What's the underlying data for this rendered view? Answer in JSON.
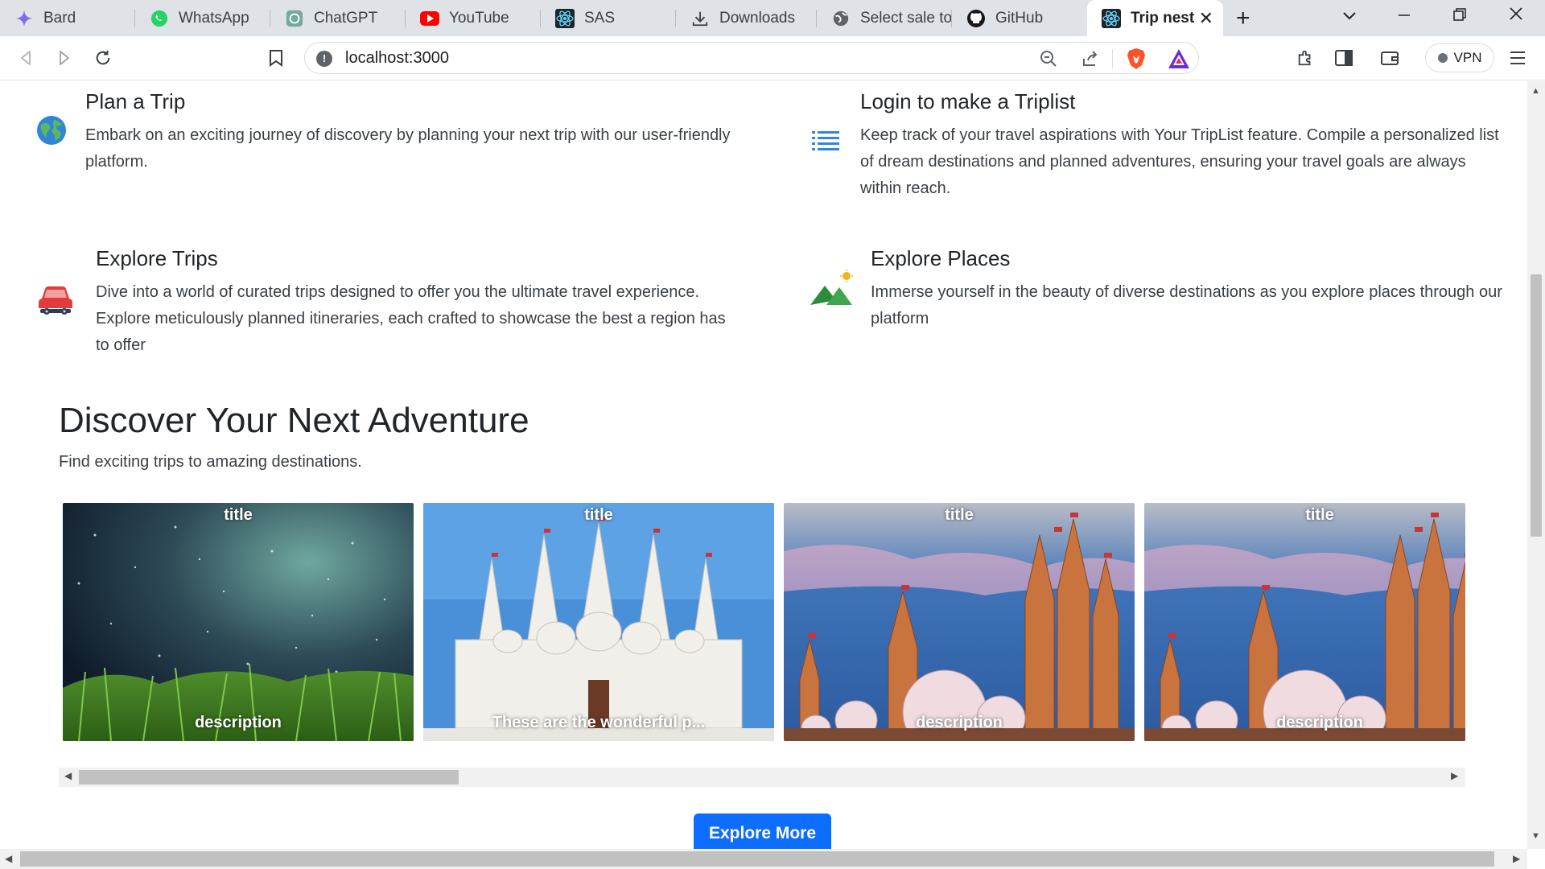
{
  "browser": {
    "tabs": [
      {
        "label": "Bard",
        "icon": "bard-icon"
      },
      {
        "label": "WhatsApp",
        "icon": "whatsapp-icon"
      },
      {
        "label": "ChatGPT",
        "icon": "chatgpt-icon"
      },
      {
        "label": "YouTube",
        "icon": "youtube-icon"
      },
      {
        "label": "SAS",
        "icon": "react-icon"
      },
      {
        "label": "Downloads",
        "icon": "download-icon"
      },
      {
        "label": "Select sale to",
        "icon": "globe-icon"
      },
      {
        "label": "GitHub",
        "icon": "github-icon"
      },
      {
        "label": "Trip nest",
        "icon": "react-icon",
        "active": true
      }
    ],
    "url": "localhost:3000",
    "vpn_label": "VPN"
  },
  "features": [
    {
      "title": "Plan a Trip",
      "description": "Embark on an exciting journey of discovery by planning your next trip with our user-friendly platform.",
      "icon": "globe-icon"
    },
    {
      "title": "Login to make a Triplist",
      "description": "Keep track of your travel aspirations with Your TripList feature. Compile a personalized list of dream destinations and planned adventures, ensuring your travel goals are always within reach.",
      "icon": "list-icon"
    },
    {
      "title": "Explore Trips",
      "description": "Dive into a world of curated trips designed to offer you the ultimate travel experience. Explore meticulously planned itineraries, each crafted to showcase the best a region has to offer",
      "icon": "car-icon"
    },
    {
      "title": "Explore Places",
      "description": "Immerse yourself in the beauty of diverse destinations as you explore places through our platform",
      "icon": "mountain-icon"
    }
  ],
  "discover": {
    "title": "Discover Your Next Adventure",
    "subtitle": "Find exciting trips to amazing destinations."
  },
  "cards": [
    {
      "title": "title",
      "description": "description"
    },
    {
      "title": "title",
      "description": "These are the wonderful p..."
    },
    {
      "title": "title",
      "description": "description"
    },
    {
      "title": "title",
      "description": "description"
    }
  ],
  "explore_button": "Explore More",
  "colors": {
    "primary": "#0d6efd",
    "tabbar": "#dfe2e7"
  }
}
